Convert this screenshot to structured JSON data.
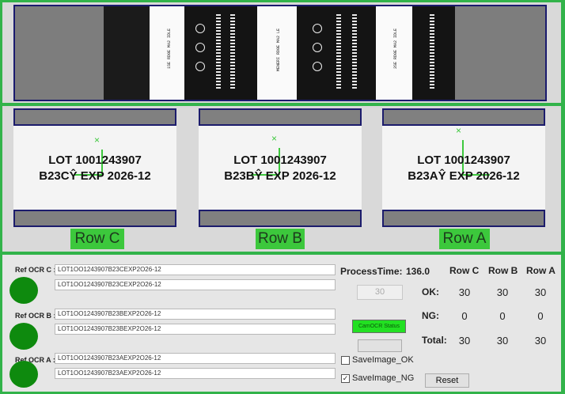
{
  "strip": {
    "panel_texts": [
      "1SE RD0E MA2 IDLE",
      "MENERI RD0E MA2 LE",
      "3SE RD0E MA2 IDLE"
    ]
  },
  "rois": [
    {
      "line1": "LOT 1001243907",
      "line2": "B23CŶ EXP 2026-12",
      "label": "Row C"
    },
    {
      "line1": "LOT 1001243907",
      "line2": "B23BŶ EXP 2026-12",
      "label": "Row B"
    },
    {
      "line1": "LOT 1001243907",
      "line2": "B23AŶ EXP 2026-12",
      "label": "Row A"
    }
  ],
  "ref": {
    "c": {
      "label": "Ref OCR C :",
      "ref_text": "LOT1OO1243907B23CEXP2O26-12",
      "read_text": "LOT1OO1243907B23CEXP2O26-12",
      "led_color": "#0e8a0e"
    },
    "b": {
      "label": "Ref OCR B :",
      "ref_text": "LOT1OO1243907B23BEXP2O26-12",
      "read_text": "LOT1OO1243907B23BEXP2O26-12",
      "led_color": "#0e8a0e"
    },
    "a": {
      "label": "Ref OCR A :",
      "ref_text": "LOT1OO1243907B23AEXP2O26-12",
      "read_text": "LOT1OO1243907B23AEXP2O26-12",
      "led_color": "#0e8a0e"
    }
  },
  "process": {
    "label": "ProcessTime:",
    "value": "136.0"
  },
  "input_value": "30",
  "status_button": "CamOCR Status",
  "stats": {
    "headers": [
      "Row C",
      "Row B",
      "Row A"
    ],
    "rows": [
      {
        "label": "OK:",
        "values": [
          "30",
          "30",
          "30"
        ]
      },
      {
        "label": "NG:",
        "values": [
          "0",
          "0",
          "0"
        ]
      },
      {
        "label": "Total:",
        "values": [
          "30",
          "30",
          "30"
        ]
      }
    ]
  },
  "save_ok": {
    "label": "SaveImage_OK",
    "checked": false
  },
  "save_ng": {
    "label": "SaveImage_NG",
    "checked": true,
    "mark": "✓"
  },
  "reset_label": "Reset",
  "colors": {
    "accent_green": "#32b34a",
    "led_ok": "#0e8a0e",
    "status_green": "#22e022"
  }
}
